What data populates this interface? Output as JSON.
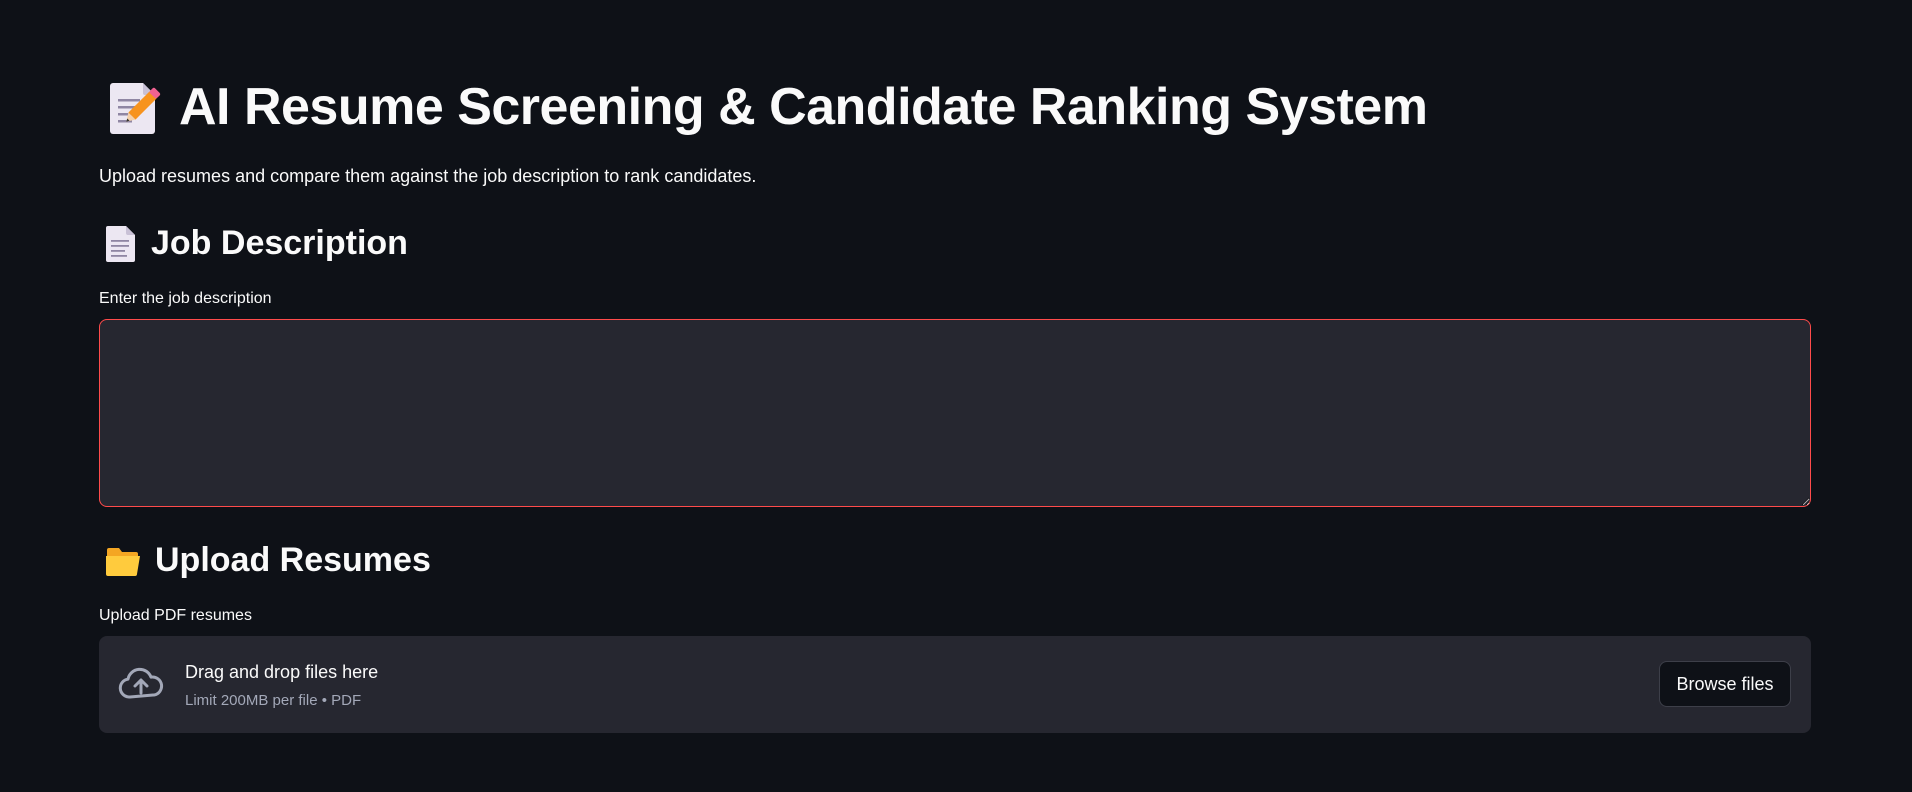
{
  "header": {
    "title": "AI Resume Screening & Candidate Ranking System",
    "title_icon": "memo-pencil-icon",
    "subtitle": "Upload resumes and compare them against the job description to rank candidates."
  },
  "job_section": {
    "heading": "Job Description",
    "heading_icon": "page-icon",
    "field_label": "Enter the job description",
    "textarea_value": "",
    "textarea_border_color": "#ff4b4b"
  },
  "upload_section": {
    "heading": "Upload Resumes",
    "heading_icon": "folder-icon",
    "field_label": "Upload PDF resumes",
    "dropzone_title": "Drag and drop files here",
    "dropzone_hint": "Limit 200MB per file • PDF",
    "dropzone_icon": "cloud-upload-icon",
    "browse_label": "Browse files"
  },
  "theme": {
    "background": "#0e1117",
    "surface": "#262730",
    "text": "#fafafa",
    "accent": "#ff4b4b"
  }
}
